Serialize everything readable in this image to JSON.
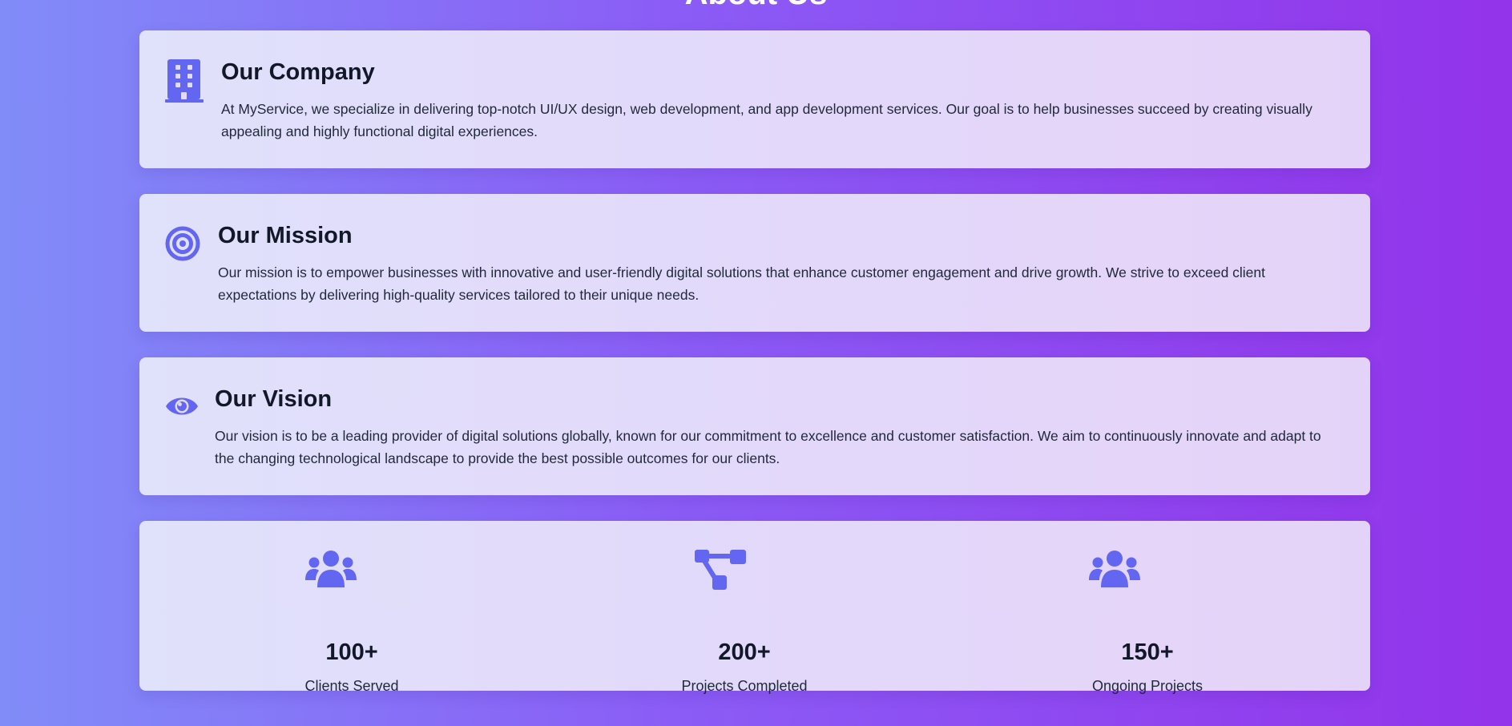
{
  "page": {
    "section_title": "About Us"
  },
  "colors": {
    "accent": "#6366f1",
    "gradient_start": "#818cf8",
    "gradient_end": "#9333ea",
    "card_background": "#e2dcfa",
    "heading_text": "#111827"
  },
  "cards": [
    {
      "icon": "building-icon",
      "title": "Our Company",
      "text": "At MyService, we specialize in delivering top-notch UI/UX design, web development, and app development services. Our goal is to help businesses succeed by creating visually appealing and highly functional digital experiences."
    },
    {
      "icon": "bullseye-icon",
      "title": "Our Mission",
      "text": "Our mission is to empower businesses with innovative and user-friendly digital solutions that enhance customer engagement and drive growth. We strive to exceed client expectations by delivering high-quality services tailored to their unique needs."
    },
    {
      "icon": "eye-icon",
      "title": "Our Vision",
      "text": "Our vision is to be a leading provider of digital solutions globally, known for our commitment to excellence and customer satisfaction. We aim to continuously innovate and adapt to the changing technological landscape to provide the best possible outcomes for our clients."
    }
  ],
  "stats": [
    {
      "icon": "users-icon",
      "number": "100+",
      "label": "Clients Served"
    },
    {
      "icon": "project-diagram-icon",
      "number": "200+",
      "label": "Projects Completed"
    },
    {
      "icon": "users-icon",
      "number": "150+",
      "label": "Ongoing Projects"
    }
  ]
}
